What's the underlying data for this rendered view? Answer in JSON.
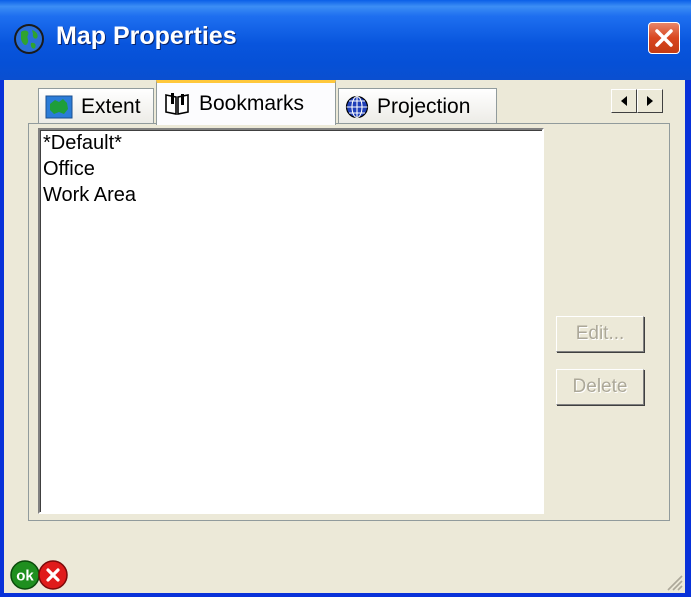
{
  "window": {
    "title": "Map Properties"
  },
  "tabs": [
    {
      "label": "Extent",
      "icon": "australia-map-icon",
      "active": false
    },
    {
      "label": "Bookmarks",
      "icon": "bookmarks-book-icon",
      "active": true
    },
    {
      "label": "Projection",
      "icon": "globe-icon",
      "active": false
    }
  ],
  "bookmarks": [
    "*Default*",
    "Office",
    "Work Area"
  ],
  "buttons": {
    "edit": "Edit...",
    "delete": "Delete"
  },
  "footer": {
    "ok_label": "ok"
  },
  "colors": {
    "titlebar": "#0855dd",
    "face": "#ece9d8",
    "tab_highlight": "#ffc83c",
    "close": "#d9461f",
    "ok": "#1f8f1f",
    "cancel": "#e01b1b"
  }
}
